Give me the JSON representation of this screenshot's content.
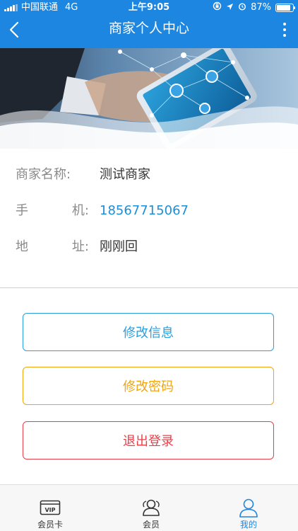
{
  "status_bar": {
    "carrier": "中国联通",
    "network": "4G",
    "time": "上午9:05",
    "battery_percent": "87%",
    "battery_level": 0.87
  },
  "nav": {
    "title": "商家个人中心",
    "back_icon": "chevron-left-icon",
    "more_icon": "more-vertical-icon"
  },
  "merchant": {
    "name_label": "商家名称:",
    "name_value": "测试商家",
    "phone_label_1": "手",
    "phone_label_2": "机:",
    "phone_value": "18567715067",
    "address_label_1": "地",
    "address_label_2": "址:",
    "address_value": "刚刚回"
  },
  "actions": {
    "edit_info": "修改信息",
    "change_password": "修改密码",
    "logout": "退出登录"
  },
  "tabs": [
    {
      "label": "会员卡",
      "icon": "vip-card-icon",
      "active": false
    },
    {
      "label": "会员",
      "icon": "members-icon",
      "active": false
    },
    {
      "label": "我的",
      "icon": "profile-icon",
      "active": true
    }
  ],
  "colors": {
    "primary": "#1d86e0",
    "blue_button": "#2a9fe0",
    "orange_button": "#f0a50f",
    "red_button": "#e8404a",
    "phone_text": "#1b8fd6"
  }
}
